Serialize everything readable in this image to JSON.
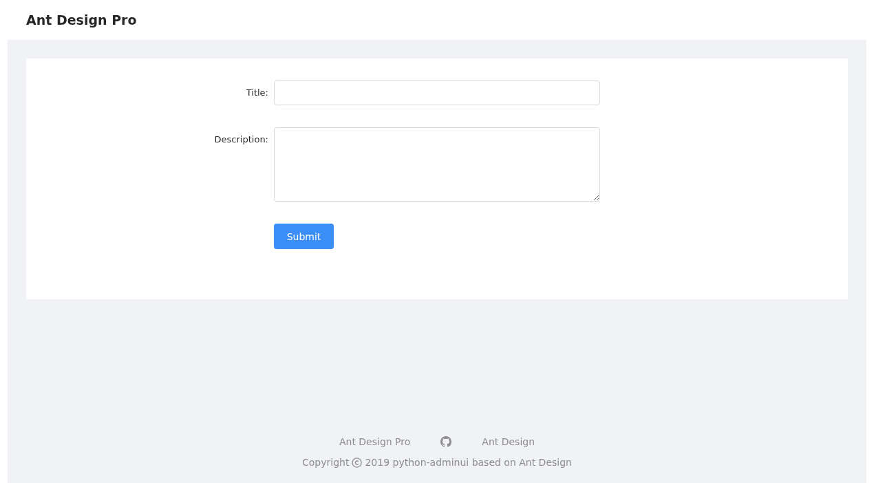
{
  "header": {
    "title": "Ant Design Pro"
  },
  "form": {
    "fields": [
      {
        "label": "Title:",
        "kind": "input"
      },
      {
        "label": "Description:",
        "kind": "textarea"
      }
    ],
    "submit": "Submit"
  },
  "footer": {
    "links": [
      {
        "kind": "text",
        "label": "Ant Design Pro"
      },
      {
        "kind": "github"
      },
      {
        "kind": "text",
        "label": "Ant Design"
      }
    ],
    "copyright_prefix": "Copyright",
    "copyright_text": "2019 python-adminui based on Ant Design"
  }
}
